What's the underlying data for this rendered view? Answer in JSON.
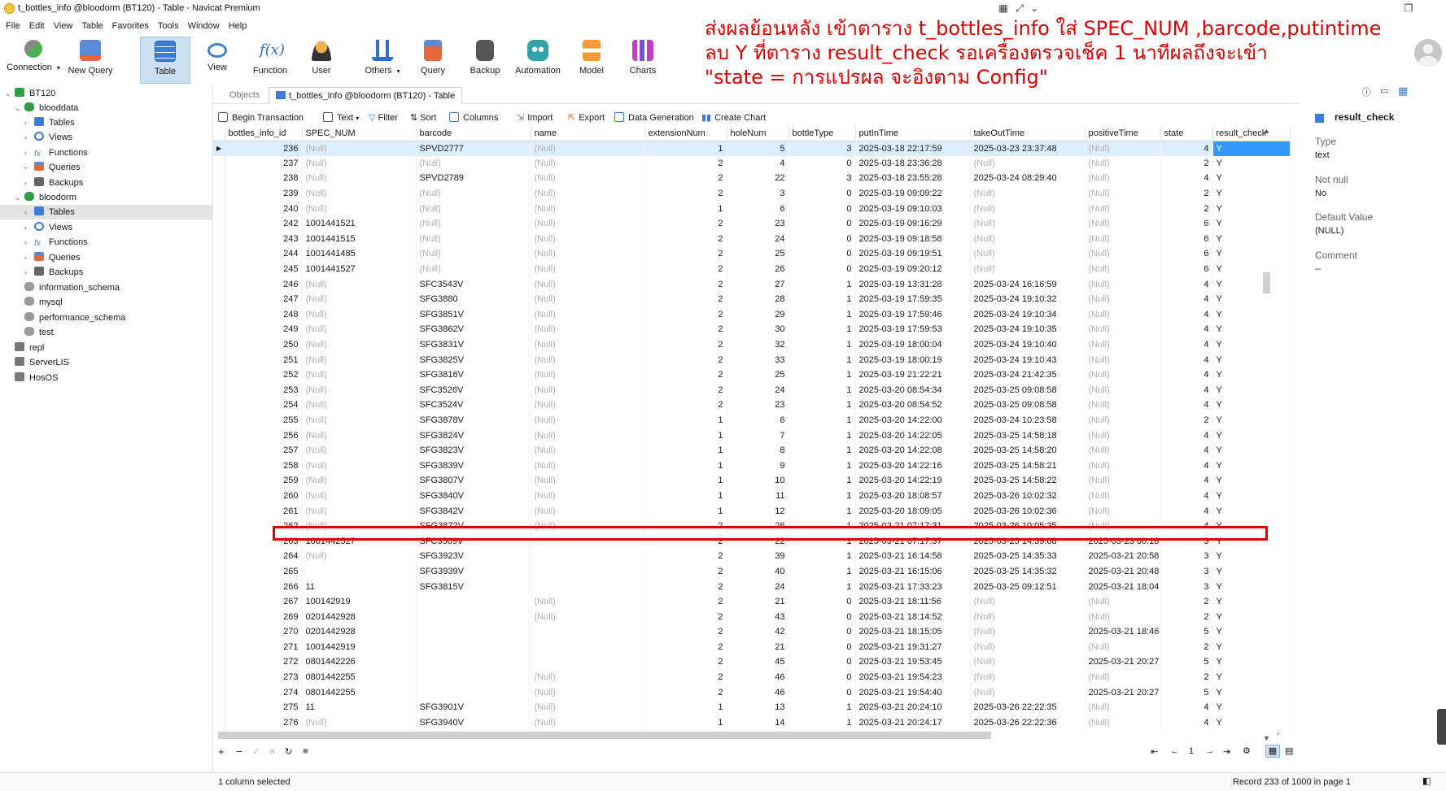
{
  "window": {
    "title": "t_bottles_info @bloodorm (BT120) - Table - Navicat Premium"
  },
  "menu": [
    "File",
    "Edit",
    "View",
    "Table",
    "Favorites",
    "Tools",
    "Window",
    "Help"
  ],
  "toolbar": {
    "connection": "Connection",
    "new_query": "New Query",
    "table": "Table",
    "view": "View",
    "function": "Function",
    "user": "User",
    "others": "Others",
    "query": "Query",
    "backup": "Backup",
    "automation": "Automation",
    "model": "Model",
    "charts": "Charts"
  },
  "sidebar": {
    "conn_main": "BT120",
    "db1": "blooddata",
    "db1_items": [
      "Tables",
      "Views",
      "Functions",
      "Queries",
      "Backups"
    ],
    "db2": "bloodorm",
    "db2_items": [
      "Tables",
      "Views",
      "Functions",
      "Queries",
      "Backups"
    ],
    "dbs": [
      "information_schema",
      "mysql",
      "performance_schema",
      "test"
    ],
    "conns": [
      "repl",
      "ServerLIS",
      "HosOS"
    ]
  },
  "tabs": {
    "objects": "Objects",
    "table_tab": "t_bottles_info @bloodorm (BT120) - Table"
  },
  "gridtools": {
    "begin_tx": "Begin Transaction",
    "text": "Text",
    "filter": "Filter",
    "sort": "Sort",
    "columns": "Columns",
    "import": "Import",
    "export": "Export",
    "data_gen": "Data Generation",
    "create_chart": "Create Chart"
  },
  "columns": [
    "bottles_info_id",
    "SPEC_NUM",
    "barcode",
    "name",
    "extensionNum",
    "holeNum",
    "bottleType",
    "putInTime",
    "takeOutTime",
    "positiveTime",
    "state",
    "result_check"
  ],
  "rows": [
    [
      "236",
      "(Null)",
      "SPVD2777",
      "(Null)",
      "1",
      "5",
      "3",
      "2025-03-18 22:17:59",
      "2025-03-23 23:37:48",
      "(Null)",
      "4",
      "Y"
    ],
    [
      "237",
      "(Null)",
      "(Null)",
      "(Null)",
      "2",
      "4",
      "0",
      "2025-03-18 23:36:28",
      "(Null)",
      "(Null)",
      "2",
      "Y"
    ],
    [
      "238",
      "(Null)",
      "SPVD2789",
      "(Null)",
      "2",
      "22",
      "3",
      "2025-03-18 23:55:28",
      "2025-03-24 08:29:40",
      "(Null)",
      "4",
      "Y"
    ],
    [
      "239",
      "(Null)",
      "(Null)",
      "(Null)",
      "2",
      "3",
      "0",
      "2025-03-19 09:09:22",
      "(Null)",
      "(Null)",
      "2",
      "Y"
    ],
    [
      "240",
      "(Null)",
      "(Null)",
      "(Null)",
      "1",
      "6",
      "0",
      "2025-03-19 09:10:03",
      "(Null)",
      "(Null)",
      "2",
      "Y"
    ],
    [
      "242",
      "1001441521",
      "(Null)",
      "(Null)",
      "2",
      "23",
      "0",
      "2025-03-19 09:16:29",
      "(Null)",
      "(Null)",
      "6",
      "Y"
    ],
    [
      "243",
      "1001441515",
      "(Null)",
      "(Null)",
      "2",
      "24",
      "0",
      "2025-03-19 09:18:58",
      "(Null)",
      "(Null)",
      "6",
      "Y"
    ],
    [
      "244",
      "1001441485",
      "(Null)",
      "(Null)",
      "2",
      "25",
      "0",
      "2025-03-19 09:19:51",
      "(Null)",
      "(Null)",
      "6",
      "Y"
    ],
    [
      "245",
      "1001441527",
      "(Null)",
      "(Null)",
      "2",
      "26",
      "0",
      "2025-03-19 09:20:12",
      "(Null)",
      "(Null)",
      "6",
      "Y"
    ],
    [
      "246",
      "(Null)",
      "SFC3543V",
      "(Null)",
      "2",
      "27",
      "1",
      "2025-03-19 13:31:28",
      "2025-03-24 16:16:59",
      "(Null)",
      "4",
      "Y"
    ],
    [
      "247",
      "(Null)",
      "SFG3880",
      "(Null)",
      "2",
      "28",
      "1",
      "2025-03-19 17:59:35",
      "2025-03-24 19:10:32",
      "(Null)",
      "4",
      "Y"
    ],
    [
      "248",
      "(Null)",
      "SFG3851V",
      "(Null)",
      "2",
      "29",
      "1",
      "2025-03-19 17:59:46",
      "2025-03-24 19:10:34",
      "(Null)",
      "4",
      "Y"
    ],
    [
      "249",
      "(Null)",
      "SFG3862V",
      "(Null)",
      "2",
      "30",
      "1",
      "2025-03-19 17:59:53",
      "2025-03-24 19:10:35",
      "(Null)",
      "4",
      "Y"
    ],
    [
      "250",
      "(Null)",
      "SFG3831V",
      "(Null)",
      "2",
      "32",
      "1",
      "2025-03-19 18:00:04",
      "2025-03-24 19:10:40",
      "(Null)",
      "4",
      "Y"
    ],
    [
      "251",
      "(Null)",
      "SFG3825V",
      "(Null)",
      "2",
      "33",
      "1",
      "2025-03-19 18:00:19",
      "2025-03-24 19:10:43",
      "(Null)",
      "4",
      "Y"
    ],
    [
      "252",
      "(Null)",
      "SFG3816V",
      "(Null)",
      "2",
      "25",
      "1",
      "2025-03-19 21:22:21",
      "2025-03-24 21:42:35",
      "(Null)",
      "4",
      "Y"
    ],
    [
      "253",
      "(Null)",
      "SFC3526V",
      "(Null)",
      "2",
      "24",
      "1",
      "2025-03-20 08:54:34",
      "2025-03-25 09:08:58",
      "(Null)",
      "4",
      "Y"
    ],
    [
      "254",
      "(Null)",
      "SFC3524V",
      "(Null)",
      "2",
      "23",
      "1",
      "2025-03-20 08:54:52",
      "2025-03-25 09:08:58",
      "(Null)",
      "4",
      "Y"
    ],
    [
      "255",
      "(Null)",
      "SFG3878V",
      "(Null)",
      "1",
      "6",
      "1",
      "2025-03-20 14:22:00",
      "2025-03-24 10:23:58",
      "(Null)",
      "2",
      "Y"
    ],
    [
      "256",
      "(Null)",
      "SFG3824V",
      "(Null)",
      "1",
      "7",
      "1",
      "2025-03-20 14:22:05",
      "2025-03-25 14:58:18",
      "(Null)",
      "4",
      "Y"
    ],
    [
      "257",
      "(Null)",
      "SFG3823V",
      "(Null)",
      "1",
      "8",
      "1",
      "2025-03-20 14:22:08",
      "2025-03-25 14:58:20",
      "(Null)",
      "4",
      "Y"
    ],
    [
      "258",
      "(Null)",
      "SFG3839V",
      "(Null)",
      "1",
      "9",
      "1",
      "2025-03-20 14:22:16",
      "2025-03-25 14:58:21",
      "(Null)",
      "4",
      "Y"
    ],
    [
      "259",
      "(Null)",
      "SFG3807V",
      "(Null)",
      "1",
      "10",
      "1",
      "2025-03-20 14:22:19",
      "2025-03-25 14:58:22",
      "(Null)",
      "4",
      "Y"
    ],
    [
      "260",
      "(Null)",
      "SFG3840V",
      "(Null)",
      "1",
      "11",
      "1",
      "2025-03-20 18:08:57",
      "2025-03-26 10:02:32",
      "(Null)",
      "4",
      "Y"
    ],
    [
      "261",
      "(Null)",
      "SFG3842V",
      "(Null)",
      "1",
      "12",
      "1",
      "2025-03-20 18:09:05",
      "2025-03-26 10:02:36",
      "(Null)",
      "4",
      "Y"
    ],
    [
      "262",
      "(Null)",
      "SFG3872V",
      "(Null)",
      "2",
      "26",
      "1",
      "2025-03-21 07:17:31",
      "2025-03-26 10:05:35",
      "(Null)",
      "4",
      "Y"
    ],
    [
      "263",
      "1001442527",
      "SFC3509V",
      "",
      "2",
      "22",
      "1",
      "2025-03-21 07:17:37",
      "2025-03-25 14:39:08",
      "2025-03-23 00:18",
      "3",
      "Y"
    ],
    [
      "264",
      "(Null)",
      "SFG3923V",
      "",
      "2",
      "39",
      "1",
      "2025-03-21 16:14:58",
      "2025-03-25 14:35:33",
      "2025-03-21 20:58",
      "3",
      "Y"
    ],
    [
      "265",
      "",
      "SFG3939V",
      "",
      "2",
      "40",
      "1",
      "2025-03-21 16:15:06",
      "2025-03-25 14:35:32",
      "2025-03-21 20:48",
      "3",
      "Y"
    ],
    [
      "266",
      "11",
      "SFG3815V",
      "",
      "2",
      "24",
      "1",
      "2025-03-21 17:33:23",
      "2025-03-25 09:12:51",
      "2025-03-21 18:04",
      "3",
      "Y"
    ],
    [
      "267",
      "100142919",
      "",
      "(Null)",
      "2",
      "21",
      "0",
      "2025-03-21 18:11:56",
      "(Null)",
      "(Null)",
      "2",
      "Y"
    ],
    [
      "269",
      "0201442928",
      "",
      "(Null)",
      "2",
      "43",
      "0",
      "2025-03-21 18:14:52",
      "(Null)",
      "(Null)",
      "2",
      "Y"
    ],
    [
      "270",
      "0201442928",
      "",
      "",
      "2",
      "42",
      "0",
      "2025-03-21 18:15:05",
      "(Null)",
      "2025-03-21 18:46",
      "5",
      "Y"
    ],
    [
      "271",
      "1001442919",
      "",
      "",
      "2",
      "21",
      "0",
      "2025-03-21 19:31:27",
      "(Null)",
      "(Null)",
      "2",
      "Y"
    ],
    [
      "272",
      "0801442226",
      "",
      "",
      "2",
      "45",
      "0",
      "2025-03-21 19:53:45",
      "(Null)",
      "2025-03-21 20:27",
      "5",
      "Y"
    ],
    [
      "273",
      "0801442255",
      "",
      "(Null)",
      "2",
      "46",
      "0",
      "2025-03-21 19:54:23",
      "(Null)",
      "(Null)",
      "2",
      "Y"
    ],
    [
      "274",
      "0801442255",
      "",
      "(Null)",
      "2",
      "46",
      "0",
      "2025-03-21 19:54:40",
      "(Null)",
      "2025-03-21 20:27",
      "5",
      "Y"
    ],
    [
      "275",
      "11",
      "SFG3901V",
      "(Null)",
      "1",
      "13",
      "1",
      "2025-03-21 20:24:10",
      "2025-03-26 22:22:35",
      "(Null)",
      "4",
      "Y"
    ],
    [
      "276",
      "(Null)",
      "SFG3940V",
      "(Null)",
      "1",
      "14",
      "1",
      "2025-03-21 20:24:17",
      "2025-03-26 22:22:36",
      "(Null)",
      "4",
      "Y"
    ]
  ],
  "pager": {
    "page": "1"
  },
  "status": {
    "left": "1 column selected",
    "right": "Record 233 of 1000 in page 1"
  },
  "right_panel": {
    "field": "result_check",
    "type_label": "Type",
    "type_value": "text",
    "notnull_label": "Not null",
    "notnull_value": "No",
    "default_label": "Default Value",
    "default_value": "(NULL)",
    "comment_label": "Comment",
    "comment_value": "--"
  },
  "annotation": {
    "line1": "ส่งผลย้อนหลัง เข้าตาราง t_bottles_info ใส่ SPEC_NUM ,barcode,putintime",
    "line2": "ลบ Y ที่ตาราง result_check รอเครื่องตรวจเช็ค 1 นาทีผลถึงจะเข้า",
    "line3": "\"state = การแปรผล จะอิงตาม Config\""
  },
  "colors": {
    "selected_cell": "#3399ff",
    "highlight_box": "#e00000",
    "annotation_text": "#e00000"
  }
}
